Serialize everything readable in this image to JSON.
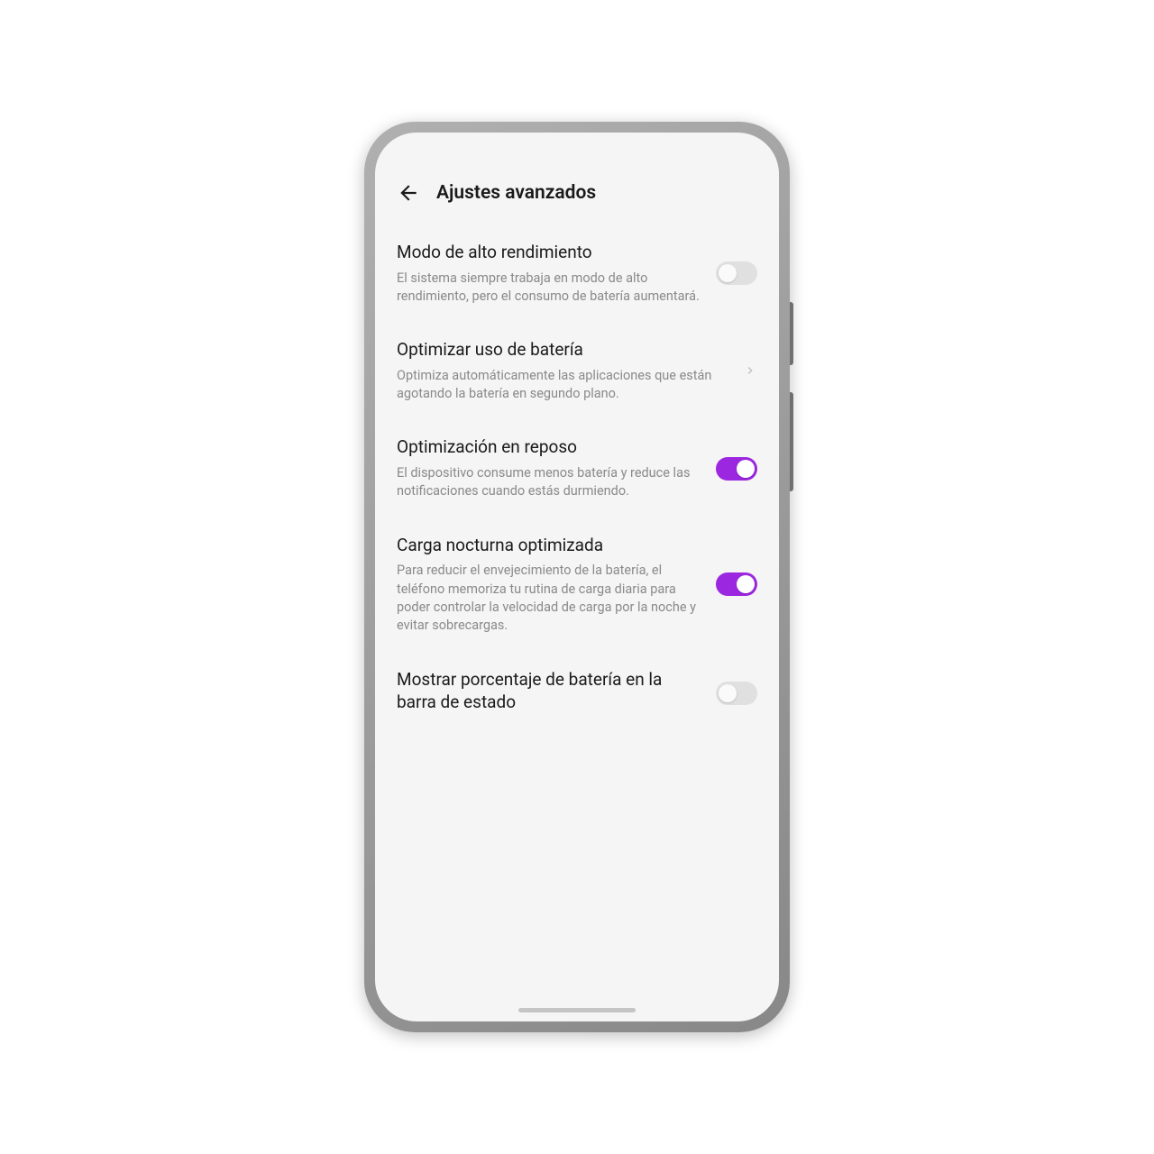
{
  "header": {
    "title": "Ajustes avanzados"
  },
  "settings": [
    {
      "title": "Modo de alto rendimiento",
      "desc": "El sistema siempre trabaja en modo de alto rendimiento, pero el consumo de batería aumentará.",
      "control": "toggle",
      "value": false
    },
    {
      "title": "Optimizar uso de batería",
      "desc": "Optimiza automáticamente las aplicaciones que están agotando la batería en segundo plano.",
      "control": "chevron"
    },
    {
      "title": "Optimización en reposo",
      "desc": "El dispositivo consume menos batería y reduce las notificaciones cuando estás durmiendo.",
      "control": "toggle",
      "value": true
    },
    {
      "title": "Carga nocturna optimizada",
      "desc": "Para reducir el envejecimiento de la batería, el teléfono memoriza tu rutina de carga diaria para poder controlar la velocidad de carga por la noche y evitar sobrecargas.",
      "control": "toggle",
      "value": true
    },
    {
      "title": "Mostrar porcentaje de batería en la barra de estado",
      "desc": "",
      "control": "toggle",
      "value": false
    }
  ],
  "colors": {
    "accent": "#9c27e0"
  }
}
